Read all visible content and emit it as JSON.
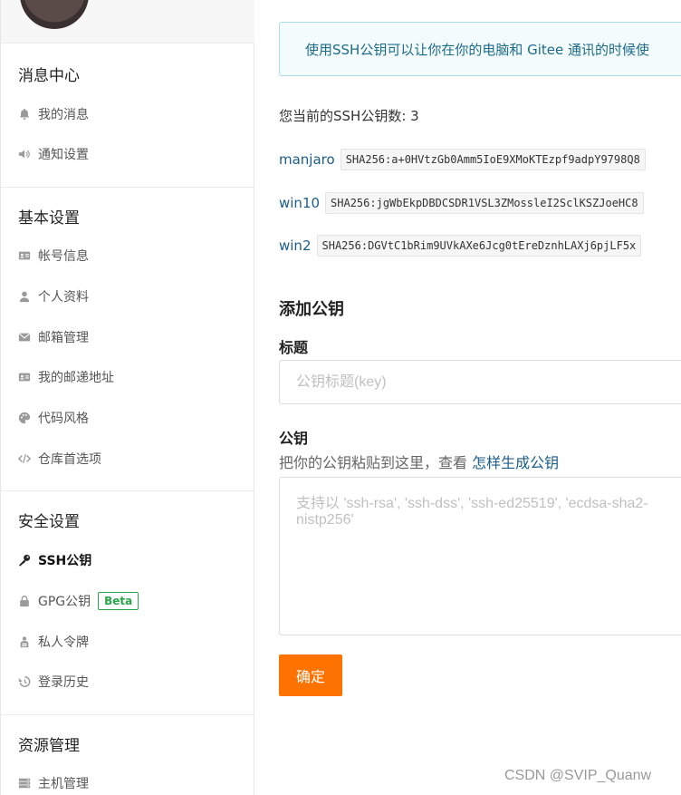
{
  "sidebar": {
    "sections": [
      {
        "title": "消息中心",
        "items": [
          {
            "label": "我的消息",
            "icon": "bell-icon"
          },
          {
            "label": "通知设置",
            "icon": "speaker-icon"
          }
        ]
      },
      {
        "title": "基本设置",
        "items": [
          {
            "label": "帐号信息",
            "icon": "id-card-icon"
          },
          {
            "label": "个人资料",
            "icon": "user-icon"
          },
          {
            "label": "邮箱管理",
            "icon": "envelope-icon"
          },
          {
            "label": "我的邮递地址",
            "icon": "address-card-icon"
          },
          {
            "label": "代码风格",
            "icon": "palette-icon"
          },
          {
            "label": "仓库首选项",
            "icon": "code-icon"
          }
        ]
      },
      {
        "title": "安全设置",
        "items": [
          {
            "label": "SSH公钥",
            "icon": "key-icon",
            "active": true
          },
          {
            "label": "GPG公钥",
            "icon": "lock-icon",
            "badge": "Beta"
          },
          {
            "label": "私人令牌",
            "icon": "token-icon"
          },
          {
            "label": "登录历史",
            "icon": "history-icon"
          }
        ]
      },
      {
        "title": "资源管理",
        "items": [
          {
            "label": "主机管理",
            "icon": "server-icon"
          }
        ]
      }
    ]
  },
  "main": {
    "info_text": "使用SSH公钥可以让你在你的电脑和 Gitee 通讯的时候使",
    "count_text": "您当前的SSH公钥数: 3",
    "keys": [
      {
        "name": "manjaro",
        "fingerprint": "SHA256:a+0HVtzGb0Amm5IoE9XMoKTEzpf9adpY9798Q8"
      },
      {
        "name": "win10",
        "fingerprint": "SHA256:jgWbEkpDBDCSDR1VSL3ZMossleI2SclKSZJoeHC8"
      },
      {
        "name": "win2",
        "fingerprint": "SHA256:DGVtC1bRim9UVkAXe6Jcg0tEreDznhLAXj6pjLF5x"
      }
    ],
    "add_title": "添加公钥",
    "title_label": "标题",
    "title_placeholder": "公钥标题(key)",
    "key_label": "公钥",
    "hint_text": "把你的公钥粘贴到这里，查看 ",
    "hint_link": "怎样生成公钥",
    "key_placeholder": "支持以 'ssh-rsa', 'ssh-dss', 'ssh-ed25519', 'ecdsa-sha2-nistp256'",
    "submit_label": "确定"
  },
  "watermark": "CSDN @SVIP_Quanw",
  "colors": {
    "accent": "#fe7300",
    "link": "#1d5d8a",
    "info_border": "#a9dee8",
    "info_bg": "#f3fbfd",
    "beta": "#2aa54a"
  }
}
